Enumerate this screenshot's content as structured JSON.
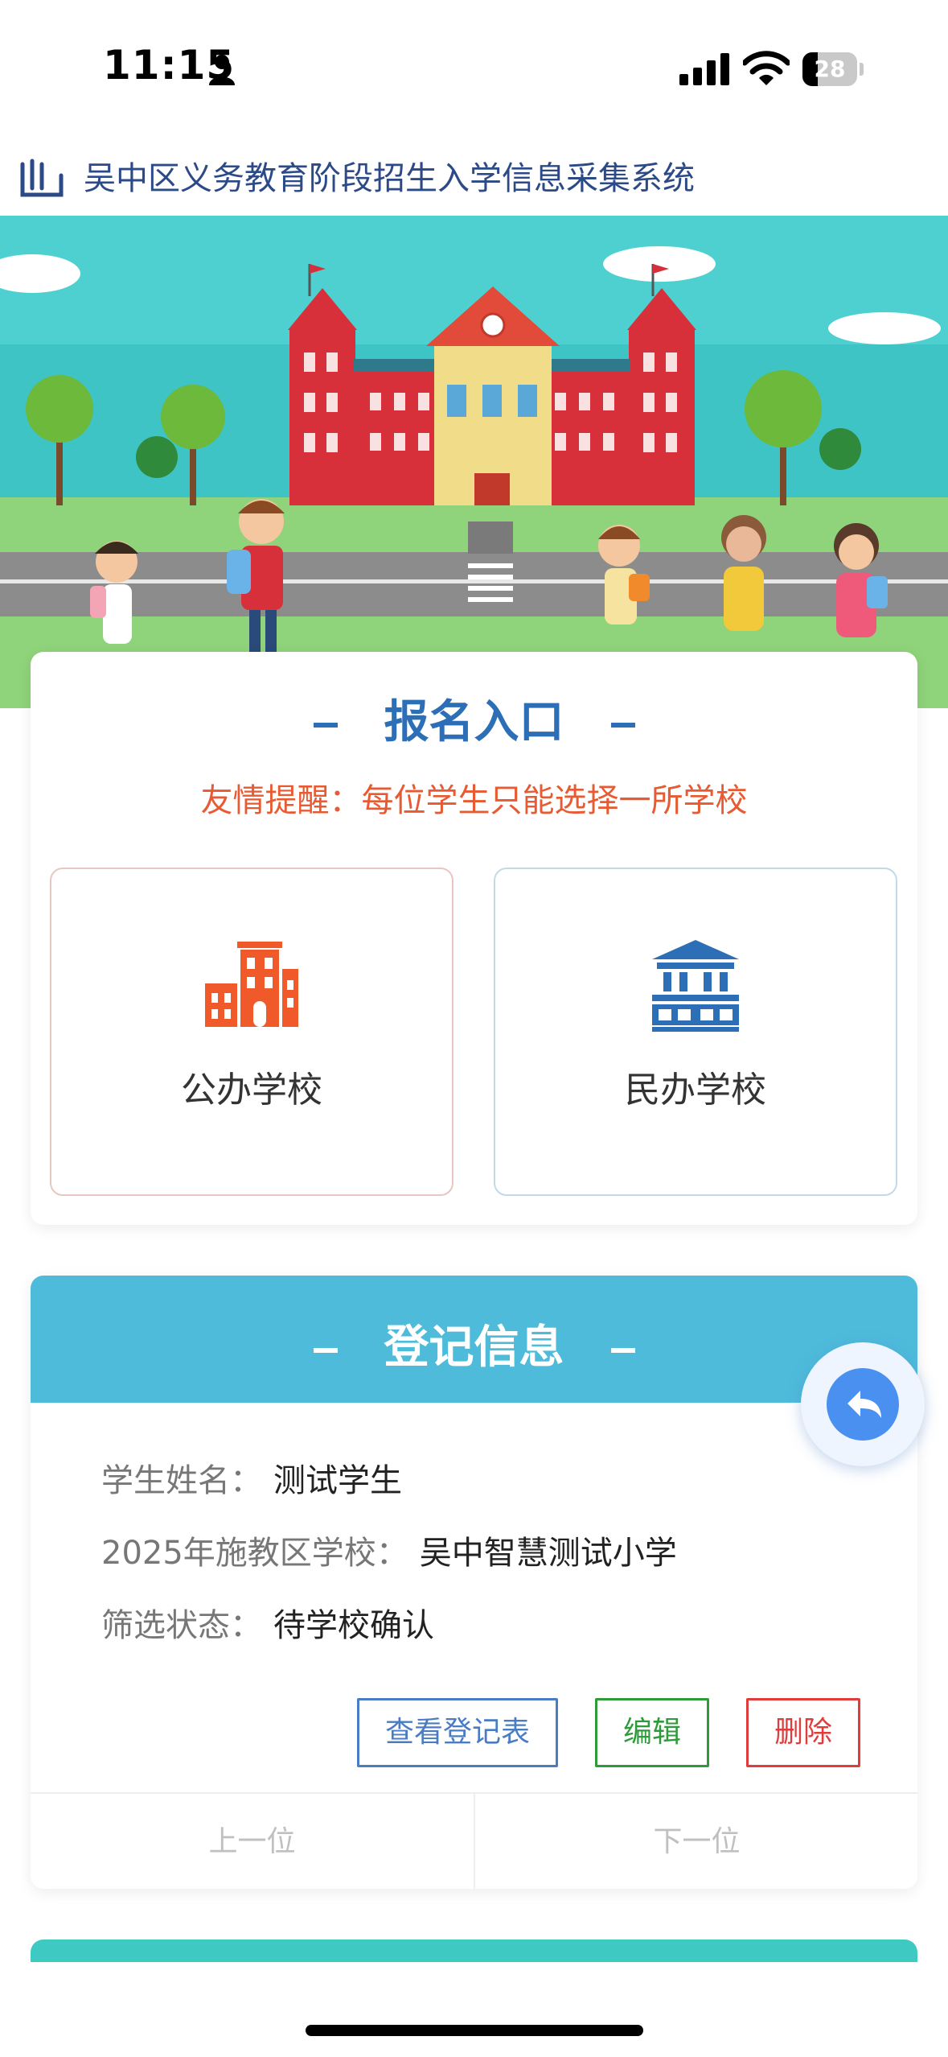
{
  "status_bar": {
    "time": "11:15",
    "battery": "28",
    "battery_level": 0.28
  },
  "app": {
    "title": "吴中区义务教育阶段招生入学信息采集系统"
  },
  "entry": {
    "title": "报名入口",
    "reminder": "友情提醒：每位学生只能选择一所学校",
    "options": [
      {
        "label": "公办学校",
        "icon": "public-school-building-icon",
        "color": "#f05a2a"
      },
      {
        "label": "民办学校",
        "icon": "institution-building-icon",
        "color": "#2c6fb7"
      }
    ]
  },
  "registration": {
    "title": "登记信息",
    "fields": [
      {
        "label": "学生姓名：",
        "value": "测试学生"
      },
      {
        "label": "2025年施教区学校：",
        "value": "吴中智慧测试小学"
      },
      {
        "label": "筛选状态：",
        "value": "待学校确认"
      }
    ],
    "buttons": {
      "view": "查看登记表",
      "edit": "编辑",
      "delete": "删除"
    },
    "pager": {
      "prev": "上一位",
      "next": "下一位"
    }
  },
  "colors": {
    "accent_blue": "#2c6fb7",
    "reminder_red": "#e85a32",
    "header_cyan": "#4ebbdb",
    "edit_green": "#2f9a3a",
    "delete_red": "#e03c3c"
  }
}
